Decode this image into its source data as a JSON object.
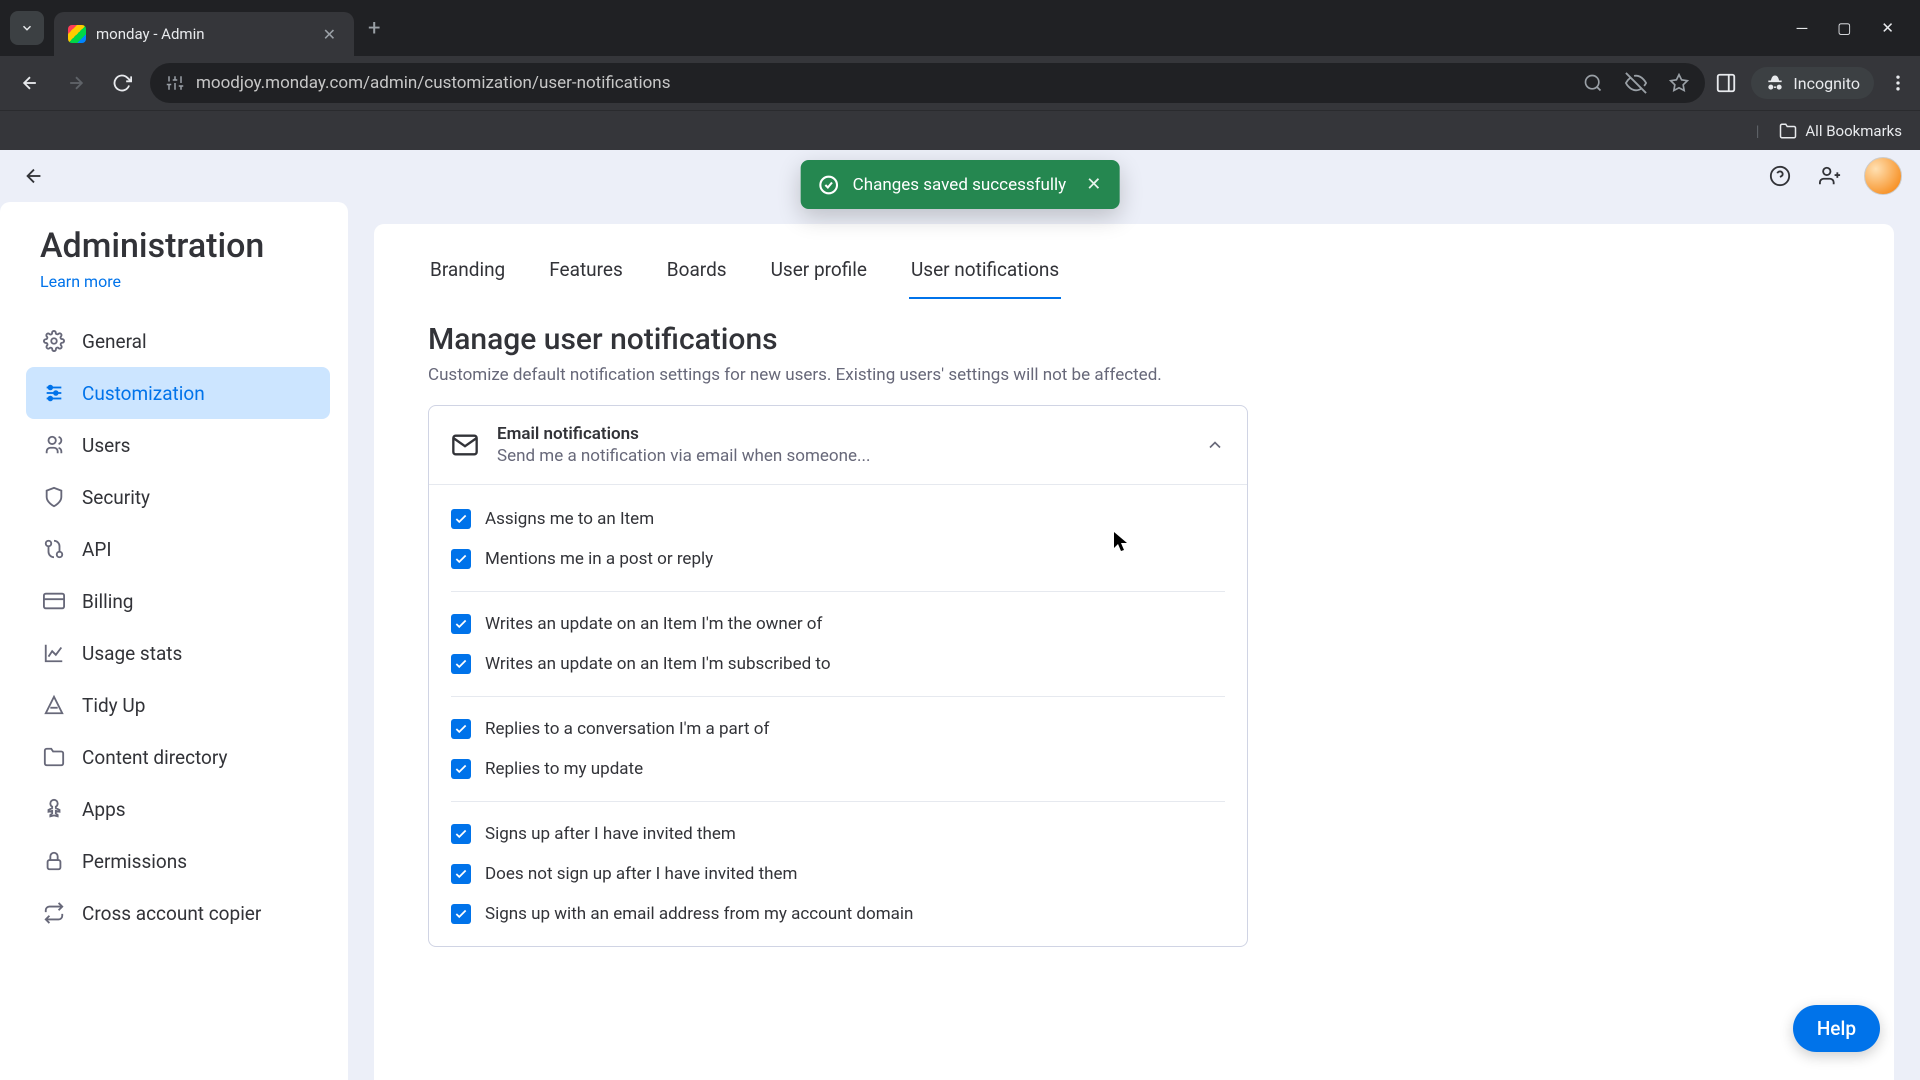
{
  "browser": {
    "tab_title": "monday - Admin",
    "url": "moodjoy.monday.com/admin/customization/user-notifications",
    "incognito_label": "Incognito",
    "all_bookmarks": "All Bookmarks"
  },
  "toast": {
    "message": "Changes saved successfully"
  },
  "sidebar": {
    "title": "Administration",
    "learn_more": "Learn more",
    "items": [
      {
        "label": "General",
        "active": false
      },
      {
        "label": "Customization",
        "active": true
      },
      {
        "label": "Users",
        "active": false
      },
      {
        "label": "Security",
        "active": false
      },
      {
        "label": "API",
        "active": false
      },
      {
        "label": "Billing",
        "active": false
      },
      {
        "label": "Usage stats",
        "active": false
      },
      {
        "label": "Tidy Up",
        "active": false
      },
      {
        "label": "Content directory",
        "active": false
      },
      {
        "label": "Apps",
        "active": false
      },
      {
        "label": "Permissions",
        "active": false
      },
      {
        "label": "Cross account copier",
        "active": false
      }
    ]
  },
  "tabs": [
    {
      "label": "Branding",
      "active": false
    },
    {
      "label": "Features",
      "active": false
    },
    {
      "label": "Boards",
      "active": false
    },
    {
      "label": "User profile",
      "active": false
    },
    {
      "label": "User notifications",
      "active": true
    }
  ],
  "section": {
    "title": "Manage user notifications",
    "subtitle": "Customize default notification settings for new users. Existing users' settings will not be affected."
  },
  "card": {
    "title": "Email notifications",
    "subtitle": "Send me a notification via email when someone...",
    "groups": [
      [
        {
          "label": "Assigns me to an Item",
          "checked": true
        },
        {
          "label": "Mentions me in a post or reply",
          "checked": true
        }
      ],
      [
        {
          "label": "Writes an update on an Item I'm the owner of",
          "checked": true
        },
        {
          "label": "Writes an update on an Item I'm subscribed to",
          "checked": true
        }
      ],
      [
        {
          "label": "Replies to a conversation I'm a part of",
          "checked": true
        },
        {
          "label": "Replies to my update",
          "checked": true
        }
      ],
      [
        {
          "label": "Signs up after I have invited them",
          "checked": true
        },
        {
          "label": "Does not sign up after I have invited them",
          "checked": true
        },
        {
          "label": "Signs up with an email address from my account domain",
          "checked": true
        }
      ]
    ]
  },
  "help_label": "Help"
}
